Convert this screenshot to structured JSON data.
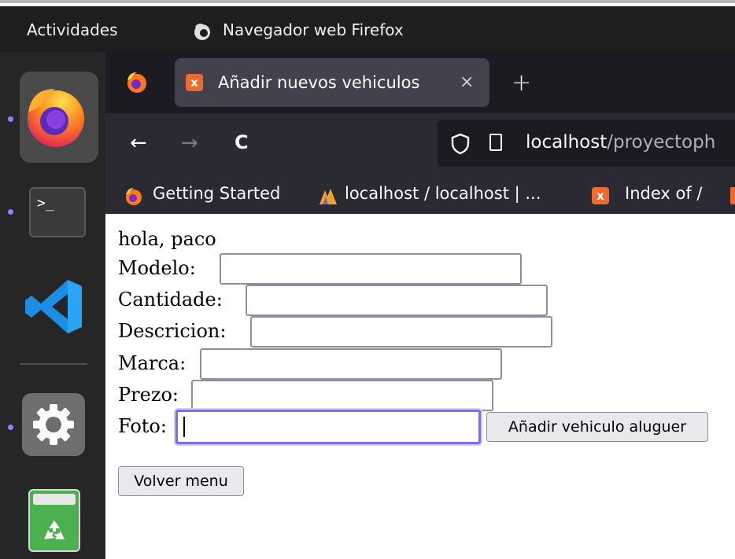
{
  "system": {
    "activities_label": "Actividades",
    "app_title": "Navegador web Firefox"
  },
  "dock": {
    "items": [
      "firefox-icon",
      "terminal-icon",
      "vscode-icon",
      "settings-icon",
      "trash-icon"
    ],
    "terminal_glyph": ">_"
  },
  "browser": {
    "tab": {
      "favicon": "x",
      "title": "Añadir nuevos vehiculos",
      "close": "×"
    },
    "new_tab": "+",
    "nav": {
      "back": "←",
      "forward": "→",
      "reload": "C"
    },
    "url": {
      "host": "localhost",
      "path": "/proyectoph"
    },
    "bookmarks": [
      {
        "label": "Getting Started",
        "icon": "firefox-icon"
      },
      {
        "label": "localhost / localhost | ...",
        "icon": "phpmyadmin-icon"
      },
      {
        "label": "Index of /",
        "icon": "xampp-icon"
      }
    ]
  },
  "page": {
    "greeting": "hola, paco",
    "fields": {
      "modelo": {
        "label": "Modelo:",
        "value": ""
      },
      "cantidade": {
        "label": "Cantidade:",
        "value": ""
      },
      "descricion": {
        "label": "Descricion:",
        "value": ""
      },
      "marca": {
        "label": "Marca:",
        "value": ""
      },
      "prezo": {
        "label": "Prezo:",
        "value": ""
      },
      "foto": {
        "label": "Foto:",
        "value": ""
      }
    },
    "submit_label": "Añadir vehiculo aluguer",
    "back_label": "Volver menu"
  },
  "colors": {
    "focus": "#7b6cf0",
    "dock_dot": "#8c83ff",
    "favicon": "#f06a2e"
  }
}
